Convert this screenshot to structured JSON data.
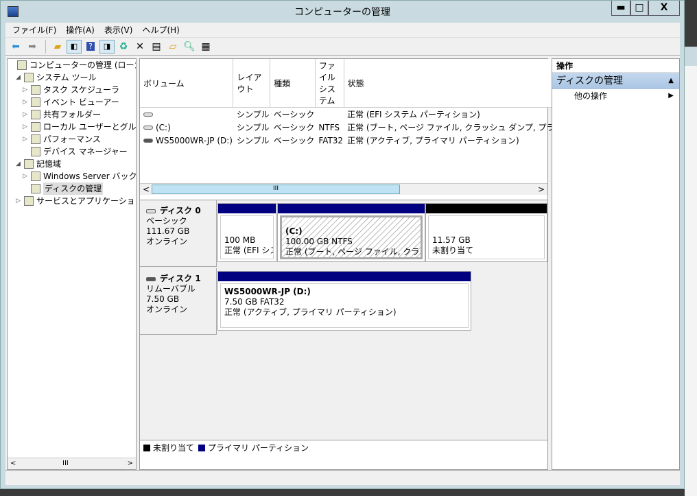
{
  "window": {
    "title": "コンピューターの管理",
    "minimize": "▬",
    "maximize": "□",
    "close": "X"
  },
  "menu": [
    "ファイル(F)",
    "操作(A)",
    "表示(V)",
    "ヘルプ(H)"
  ],
  "toolbar_icons": [
    "back-icon",
    "forward-icon",
    "up-folder-icon",
    "show-hide-tree-icon",
    "help-icon",
    "show-hide-action-icon",
    "refresh-icon",
    "delete-icon",
    "properties-icon",
    "open-icon",
    "search-icon",
    "settings-icon"
  ],
  "tree": [
    {
      "label": "コンピューターの管理 (ローカル)",
      "level": 0,
      "arrow": ""
    },
    {
      "label": "システム ツール",
      "level": 1,
      "arrow": "◢"
    },
    {
      "label": "タスク スケジューラ",
      "level": 2,
      "arrow": "▷"
    },
    {
      "label": "イベント ビューアー",
      "level": 2,
      "arrow": "▷"
    },
    {
      "label": "共有フォルダー",
      "level": 2,
      "arrow": "▷"
    },
    {
      "label": "ローカル ユーザーとグループ",
      "level": 2,
      "arrow": "▷"
    },
    {
      "label": "パフォーマンス",
      "level": 2,
      "arrow": "▷"
    },
    {
      "label": "デバイス マネージャー",
      "level": 2,
      "arrow": ""
    },
    {
      "label": "記憶域",
      "level": 1,
      "arrow": "◢"
    },
    {
      "label": "Windows Server バックアップ",
      "level": 2,
      "arrow": "▷"
    },
    {
      "label": "ディスクの管理",
      "level": 2,
      "arrow": "",
      "selected": true
    },
    {
      "label": "サービスとアプリケーション",
      "level": 1,
      "arrow": "▷"
    }
  ],
  "volumes": {
    "columns": [
      "ボリューム",
      "レイアウト",
      "種類",
      "ファイル システム",
      "状態"
    ],
    "rows": [
      [
        "",
        "シンプル",
        "ベーシック",
        "",
        "正常 (EFI システム パーティション)"
      ],
      [
        "(C:)",
        "シンプル",
        "ベーシック",
        "NTFS",
        "正常 (ブート, ページ ファイル, クラッシュ ダンプ, プライマリ パーティション)"
      ],
      [
        "WS5000WR-JP (D:)",
        "シンプル",
        "ベーシック",
        "FAT32",
        "正常 (アクティブ, プライマリ パーティション)"
      ]
    ]
  },
  "disks": [
    {
      "name": "ディスク 0",
      "type": "ベーシック",
      "size": "111.67 GB",
      "status": "オンライン",
      "partitions": [
        {
          "title": "",
          "line1": "100 MB",
          "line2": "正常 (EFI システム パーティション)",
          "bar": "#000080"
        },
        {
          "title": "(C:)",
          "line1": "100.00 GB NTFS",
          "line2": "正常 (ブート, ページ ファイル, クラッシュ ダンプ, プライマリ パーティション)",
          "bar": "#000080"
        },
        {
          "title": "",
          "line1": "11.57 GB",
          "line2": "未割り当て",
          "bar": "#000000"
        }
      ]
    },
    {
      "name": "ディスク 1",
      "type": "リムーバブル",
      "size": "7.50 GB",
      "status": "オンライン",
      "partitions": [
        {
          "title": "WS5000WR-JP  (D:)",
          "line1": "7.50 GB FAT32",
          "line2": "正常 (アクティブ, プライマリ パーティション)",
          "bar": "#000080"
        }
      ]
    }
  ],
  "legend": [
    {
      "label": "未割り当て",
      "color": "#000000"
    },
    {
      "label": "プライマリ パーティション",
      "color": "#000080"
    }
  ],
  "actions": {
    "header": "操作",
    "section": "ディスクの管理",
    "item": "他の操作"
  }
}
